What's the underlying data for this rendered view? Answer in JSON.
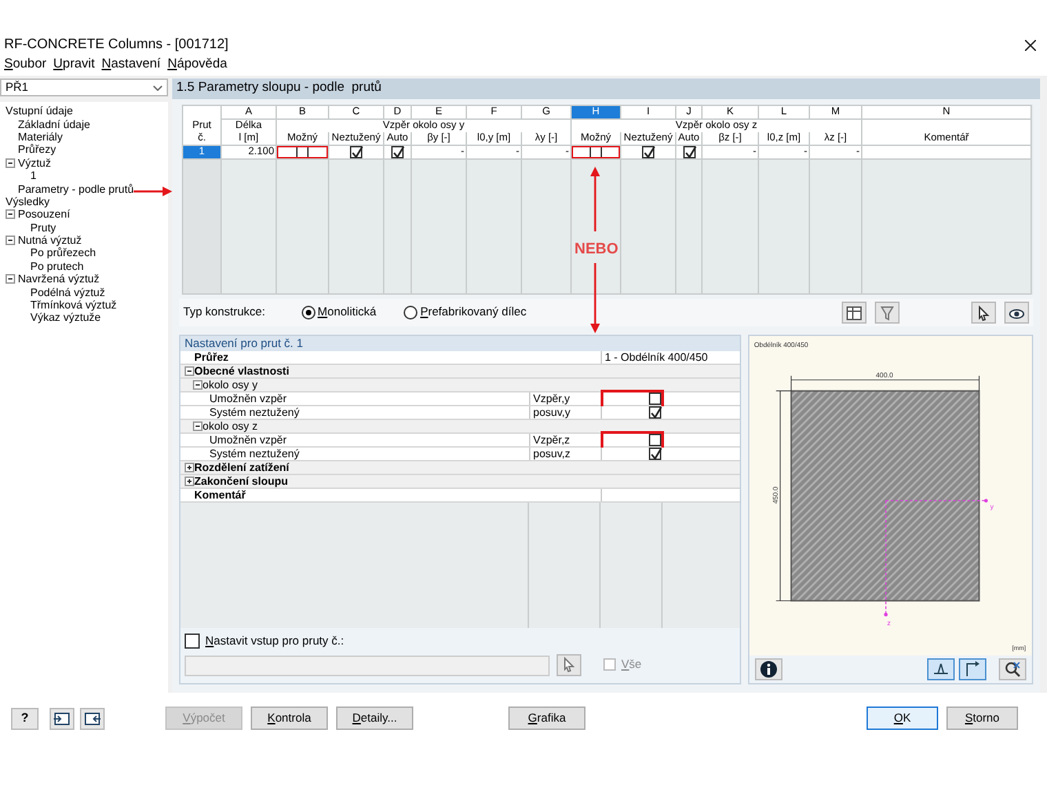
{
  "window": {
    "title": "RF-CONCRETE Columns - [001712]"
  },
  "menu": [
    "Soubor",
    "Upravit",
    "Nastavení",
    "Nápověda"
  ],
  "case_selector": {
    "value": "PŘ1"
  },
  "tree": [
    {
      "label": "Vstupní údaje",
      "children": [
        {
          "label": "Základní údaje"
        },
        {
          "label": "Materiály"
        },
        {
          "label": "Průřezy"
        },
        {
          "label": "Výztuž",
          "expanded": true,
          "children": [
            {
              "label": "1"
            }
          ]
        },
        {
          "label": "Parametry - podle prutů"
        }
      ]
    },
    {
      "label": "Výsledky",
      "children": [
        {
          "label": "Posouzení",
          "expanded": true,
          "children": [
            {
              "label": "Pruty"
            }
          ]
        },
        {
          "label": "Nutná výztuž",
          "expanded": true,
          "children": [
            {
              "label": "Po průřezech"
            },
            {
              "label": "Po prutech"
            }
          ]
        },
        {
          "label": "Navržená výztuž",
          "expanded": true,
          "children": [
            {
              "label": "Podélná výztuž"
            },
            {
              "label": "Třmínková výztuž"
            },
            {
              "label": "Výkaz výztuže"
            }
          ]
        }
      ]
    }
  ],
  "panel": {
    "title": "1.5 Parametry sloupu - podle  prutů"
  },
  "table": {
    "columns": [
      {
        "top": "Prut",
        "label": "č.",
        "selected": false
      },
      {
        "letter": "A",
        "top": "Délka",
        "label": "l [m]",
        "selected": false
      },
      {
        "group": "Vzpěr okolo osy y",
        "columns": [
          {
            "letter": "B",
            "label": "Možný",
            "selected": false
          },
          {
            "letter": "C",
            "label": "Neztužený",
            "selected": false
          },
          {
            "letter": "D",
            "label": "Auto",
            "selected": false
          },
          {
            "letter": "E",
            "label": "βy [-]",
            "selected": false
          },
          {
            "letter": "F",
            "label": "l0,y [m]",
            "selected": false
          },
          {
            "letter": "G",
            "label": "λy [-]",
            "selected": false
          }
        ]
      },
      {
        "group": "Vzpěr okolo osy z",
        "columns": [
          {
            "letter": "H",
            "label": "Možný",
            "selected": true
          },
          {
            "letter": "I",
            "label": "Neztužený",
            "selected": false
          },
          {
            "letter": "J",
            "label": "Auto",
            "selected": false
          },
          {
            "letter": "K",
            "label": "βz [-]",
            "selected": false
          },
          {
            "letter": "L",
            "label": "l0,z [m]",
            "selected": false
          },
          {
            "letter": "M",
            "label": "λz [-]",
            "selected": false
          }
        ]
      },
      {
        "letter": "N",
        "label": "Komentář",
        "selected": false
      }
    ],
    "rows": [
      {
        "selected": true,
        "cells": [
          {
            "kind": "text",
            "text": "1"
          },
          {
            "kind": "text",
            "text": "2.100"
          },
          {
            "kind": "check",
            "checked": false,
            "highlighted": true
          },
          {
            "kind": "check",
            "checked": true
          },
          {
            "kind": "check",
            "checked": true
          },
          {
            "kind": "text",
            "text": "-"
          },
          {
            "kind": "text",
            "text": "-"
          },
          {
            "kind": "text",
            "text": "-"
          },
          {
            "kind": "check",
            "checked": false,
            "highlighted": true
          },
          {
            "kind": "check",
            "checked": true
          },
          {
            "kind": "check",
            "checked": true
          },
          {
            "kind": "text",
            "text": "-"
          },
          {
            "kind": "text",
            "text": "-"
          },
          {
            "kind": "text",
            "text": "-"
          },
          {
            "kind": "empty"
          }
        ]
      }
    ]
  },
  "construction": {
    "label": "Typ konstrukce:",
    "options": [
      {
        "label": "Monolitická",
        "selected": true
      },
      {
        "label": "Prefabrikovaný dílec",
        "selected": false
      }
    ]
  },
  "annotation": {
    "label": "NEBO"
  },
  "settings": {
    "title": "Nastavení pro prut č. 1",
    "rows": [
      {
        "kind": "header",
        "label": "Průřez",
        "value": "1 - Obdélník 400/450"
      },
      {
        "kind": "group",
        "label": "Obecné vlastnosti",
        "expanded": true,
        "children": [
          {
            "kind": "subgroup",
            "label": "okolo osy y",
            "expanded": true,
            "children": [
              {
                "kind": "item",
                "label": "Umožněn vzpěr",
                "symbol": "Vzpěr,y",
                "checked": false,
                "highlighted": true
              },
              {
                "kind": "item",
                "label": "Systém neztužený",
                "symbol": "posuv,y",
                "checked": true
              }
            ]
          },
          {
            "kind": "subgroup",
            "label": "okolo osy z",
            "expanded": true,
            "children": [
              {
                "kind": "item",
                "label": "Umožněn vzpěr",
                "symbol": "Vzpěr,z",
                "checked": false,
                "highlighted": true
              },
              {
                "kind": "item",
                "label": "Systém neztužený",
                "symbol": "posuv,z",
                "checked": true
              }
            ]
          }
        ]
      },
      {
        "kind": "group",
        "label": "Rozdělení zatížení",
        "expanded": false
      },
      {
        "kind": "group",
        "label": "Zakončení sloupu",
        "expanded": false
      },
      {
        "kind": "header",
        "label": "Komentář"
      }
    ]
  },
  "apply_to": {
    "label": "Nastavit vstup pro pruty č.:",
    "checked": false
  },
  "select_all": {
    "label": "Vše",
    "checked": false,
    "disabled": true
  },
  "preview": {
    "title": "Obdélník 400/450",
    "width_label": "400.0",
    "height_label": "450.0",
    "axis_y": "y",
    "axis_z": "z",
    "units": "[mm]"
  },
  "help_button": {
    "label": "?"
  },
  "buttons": [
    {
      "label": "Výpočet",
      "disabled": true,
      "default": false
    },
    {
      "label": "Kontrola",
      "disabled": false,
      "default": false
    },
    {
      "label": "Detaily...",
      "disabled": false,
      "default": false
    },
    {
      "label": "Grafika",
      "disabled": false,
      "default": false
    },
    {
      "label": "OK",
      "disabled": false,
      "default": true
    },
    {
      "label": "Storno",
      "disabled": false,
      "default": false
    }
  ]
}
